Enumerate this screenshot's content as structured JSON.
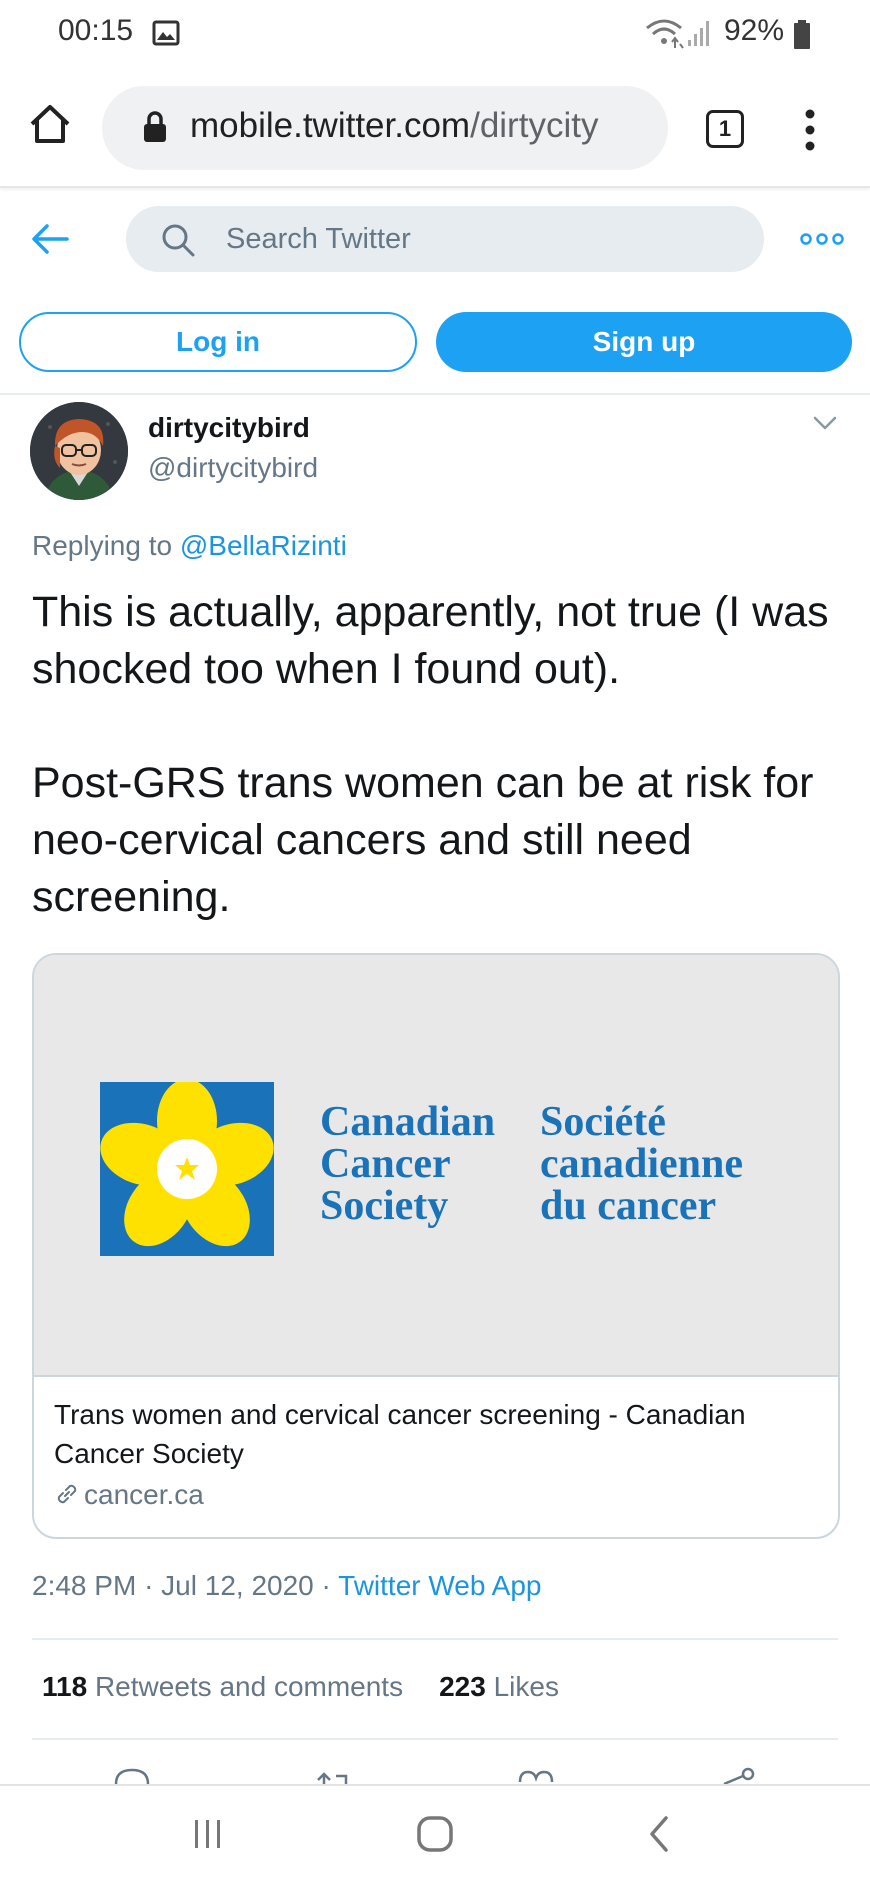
{
  "status_bar": {
    "time": "00:15",
    "battery": "92%",
    "icons": [
      "image-icon",
      "wifi-icon",
      "signal-icon",
      "battery-icon"
    ]
  },
  "browser": {
    "url_domain": "mobile.twitter.com",
    "url_path": "/dirtycity",
    "tab_count": "1"
  },
  "twitter_header": {
    "search_placeholder": "Search Twitter"
  },
  "auth": {
    "login_label": "Log in",
    "signup_label": "Sign up"
  },
  "tweet": {
    "display_name": "dirtycitybird",
    "handle": "@dirtycitybird",
    "replying_prefix": "Replying to ",
    "replying_to": "@BellaRizinti",
    "text_para1": "This is actually, apparently, not true (I was shocked too when I found out).",
    "text_para2": "Post-GRS trans women can be at risk for neo-cervical cancers and still need screening.",
    "time": "2:48 PM",
    "date": "Jul 12, 2020",
    "separator": "·",
    "source": "Twitter Web App",
    "retweets_count": "118",
    "retweets_label": "Retweets and comments",
    "likes_count": "223",
    "likes_label": "Likes"
  },
  "card": {
    "logo_en": [
      "Canadian",
      "Cancer",
      "Society"
    ],
    "logo_fr": [
      "Société",
      "canadienne",
      "du cancer"
    ],
    "title": "Trans women and cervical cancer screening - Canadian Cancer Society",
    "domain": "cancer.ca"
  },
  "colors": {
    "twitter_blue": "#1da1f2",
    "link_blue": "#1b95e0",
    "secondary_text": "#657786",
    "logo_blue": "#1a73b8",
    "logo_yellow": "#ffe100"
  }
}
